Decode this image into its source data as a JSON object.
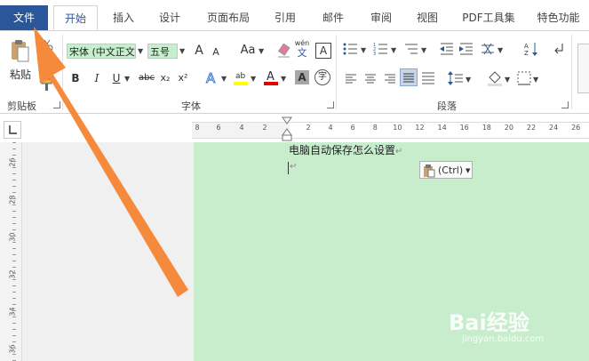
{
  "tabs": {
    "file": "文件",
    "home": "开始",
    "insert": "插入",
    "design": "设计",
    "layout": "页面布局",
    "references": "引用",
    "mailings": "邮件",
    "review": "审阅",
    "view": "视图",
    "pdf": "PDF工具集",
    "special": "特色功能"
  },
  "ribbon": {
    "clipboard_group": "剪贴板",
    "paste_label": "粘贴",
    "font_group": "字体",
    "paragraph_group": "段落",
    "font_name": "宋体 (中文正文",
    "font_size": "五号",
    "bold": "B",
    "italic": "I",
    "underline": "U",
    "strike": "abc",
    "subscript": "x₂",
    "superscript": "x²",
    "case": "Aa",
    "grow": "A",
    "shrink": "A",
    "phonetic_top": "wén",
    "phonetic_bottom": "文",
    "border_char": "A",
    "shade_char": "A",
    "circle_char": "字"
  },
  "ruler": {
    "h_left": [
      "8",
      "6",
      "4",
      "2"
    ],
    "h_right": [
      "2",
      "4",
      "6",
      "8",
      "10",
      "12",
      "14",
      "16",
      "18",
      "20",
      "22",
      "24",
      "26"
    ],
    "v": [
      "26",
      "28",
      "30",
      "32",
      "34",
      "36"
    ]
  },
  "document": {
    "line1": "电脑自动保存怎么设置",
    "para_mark": "↵",
    "paste_options": "(Ctrl)"
  },
  "watermark": {
    "brand": "Bai经验",
    "url": "jingyan.baidu.com"
  },
  "colors": {
    "accent": "#2b579a",
    "page_bg": "#c7edcc",
    "arrow": "#f68a3c"
  }
}
